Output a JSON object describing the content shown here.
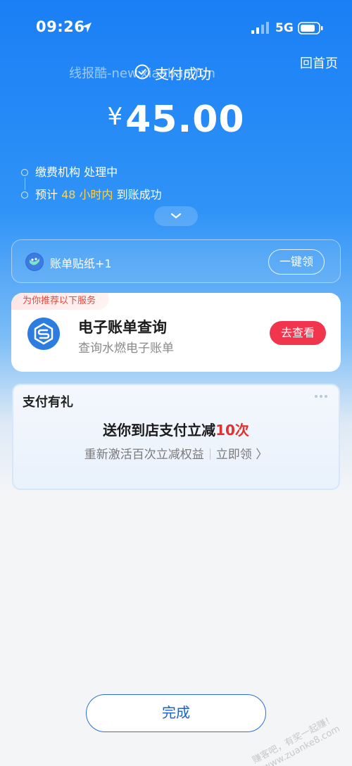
{
  "status_bar": {
    "time": "09:26",
    "network": "5G"
  },
  "header": {
    "home_link": "回首页",
    "title": "支付成功",
    "watermark": "线报酷-new.xianbao.fun"
  },
  "amount": {
    "currency": "¥",
    "value": "45.00"
  },
  "timeline": {
    "step1": "缴费机构 处理中",
    "step2_prefix": "预计 ",
    "step2_highlight": "48 小时内",
    "step2_suffix": " 到账成功"
  },
  "sticker": {
    "label": "账单贴纸+1",
    "claim_button": "一键领"
  },
  "service": {
    "tag": "为你推荐以下服务",
    "title": "电子账单查询",
    "subtitle": "查询水燃电子账单",
    "button": "去查看"
  },
  "gift": {
    "title": "支付有礼",
    "main_prefix": "送你到店支付立减",
    "main_highlight": "10次",
    "sub_left": "重新激活百次立减权益",
    "sub_right": "立即领 〉"
  },
  "done_button": "完成",
  "corner_watermark": {
    "line1": "赚客吧，有奖一起赚！",
    "line2": "www.zuanke8.com"
  },
  "colors": {
    "primary_blue": "#1a7ff5",
    "red": "#f0354c",
    "highlight_yellow": "#ffd24a"
  }
}
